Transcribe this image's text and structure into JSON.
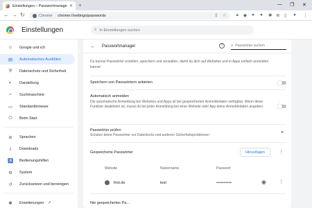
{
  "browser": {
    "tab_title": "Einstellungen – Passwortmanager",
    "url_source": "Chrome",
    "url": "chrome://settings/passwords"
  },
  "settings": {
    "title": "Einstellungen",
    "search_placeholder": "In Einstellungen suchen"
  },
  "sidebar": {
    "items": [
      {
        "label": "Google und ich",
        "icon": "person-icon"
      },
      {
        "label": "Automatisches Ausfüllen",
        "icon": "autofill-icon"
      },
      {
        "label": "Datenschutz und Sicherheit",
        "icon": "shield-icon"
      },
      {
        "label": "Darstellung",
        "icon": "palette-icon"
      },
      {
        "label": "Suchmaschine",
        "icon": "search-icon"
      },
      {
        "label": "Standardbrowser",
        "icon": "browser-icon"
      },
      {
        "label": "Beim Start",
        "icon": "power-icon"
      },
      {
        "label": "Sprachen",
        "icon": "globe-icon"
      },
      {
        "label": "Downloads",
        "icon": "download-icon"
      },
      {
        "label": "Bedienungshilfen",
        "icon": "accessibility-icon"
      },
      {
        "label": "System",
        "icon": "wrench-icon"
      },
      {
        "label": "Zurücksetzen und bereinigen",
        "icon": "reset-icon"
      },
      {
        "label": "Erweiterungen",
        "icon": "extension-icon"
      }
    ]
  },
  "passwords": {
    "title": "Passwortmanager",
    "search_placeholder": "Passwörter suchen",
    "intro": "Du kannst Passwörter erstellen, speichern und verwalten, damit du dich auf Websites und in Apps einfach anmelden kannst",
    "save_offer_label": "Speichern von Passwörtern anbieten",
    "auto_signin_label": "Automatisch anmelden",
    "auto_signin_desc": "Die automatische Anmeldung bei Websites und Apps ist bei gespeicherten Anmeldedaten verfügbar. Wenn diese Funktion deaktiviert ist, musst du bei jeder Anmeldung bei einer Website oder App deine Anmeldedaten angeben.",
    "check_label": "Passwörter prüfen",
    "check_desc": "Schütze deine Passwörter vor Datenlecks und anderen Sicherheitsproblemen",
    "saved_label": "Gespeicherte Passwörter",
    "add_button": "Hinzufügen",
    "columns": [
      "Website",
      "Nutzername",
      "Passwort"
    ],
    "rows": [
      {
        "site": "first.de",
        "user": "test",
        "password": "••••••••••"
      }
    ],
    "never_saved_label": "Nie gespeichertes Pa..."
  }
}
